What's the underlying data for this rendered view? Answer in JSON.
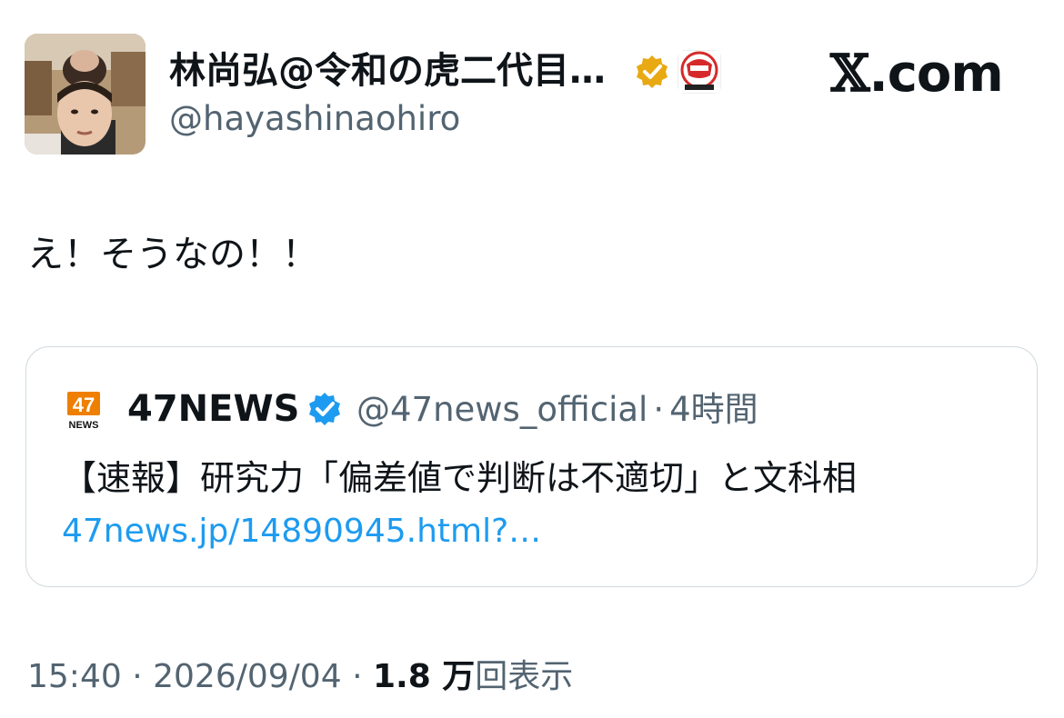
{
  "header": {
    "display_name": "林尚弘@令和の虎二代目…",
    "handle": "@hayashinaohiro",
    "brand": {
      "x": "𝕏",
      "suffix": ".com"
    },
    "verified_color": "#e8a913",
    "affiliate_icon": "reiwa-no-tora-channel-logo"
  },
  "tweet": {
    "text": "え！そうなの！！"
  },
  "quote": {
    "logo_text": "47",
    "logo_sub": "NEWS",
    "name": "47NEWS",
    "handle": "@47news_official",
    "sep": "·",
    "time": "4時間",
    "text": "【速報】研究力「偏差値で判断は不適切」と文科相",
    "link": "47news.jp/14890945.html?…",
    "verified_color": "#1d9bf0"
  },
  "meta": {
    "time": "15:40",
    "sep1": "·",
    "date": "2026/09/04",
    "sep2": "·",
    "views": "1.8 万",
    "views_label": "回表示"
  }
}
